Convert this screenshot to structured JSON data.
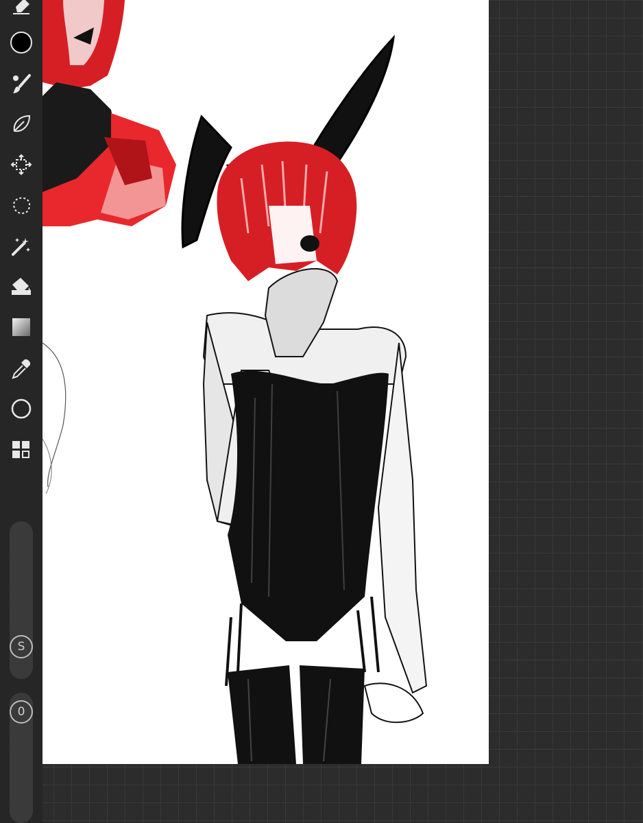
{
  "app": {
    "colors": {
      "workspace": "#2c2c2d",
      "grid": "#3a3a3b",
      "toolbar": "#262627",
      "canvas": "#ffffff",
      "hair_red": "#d61f25",
      "ink": "#0d0d0d"
    }
  },
  "toolbar": {
    "tools": [
      {
        "icon": "eraser-icon",
        "active": false
      },
      {
        "icon": "color-swatch-icon",
        "color": "#000000"
      },
      {
        "icon": "brush-icon"
      },
      {
        "icon": "smudge-icon"
      },
      {
        "icon": "transform-icon"
      },
      {
        "icon": "lasso-selection-icon"
      },
      {
        "icon": "magic-wand-icon"
      },
      {
        "icon": "fill-bucket-icon"
      },
      {
        "icon": "gradient-icon"
      },
      {
        "icon": "eyedropper-icon"
      },
      {
        "icon": "shape-circle-icon"
      },
      {
        "icon": "layers-icon"
      }
    ],
    "size_slider": {
      "label": "S"
    },
    "opacity_slider": {
      "label": "0"
    }
  }
}
